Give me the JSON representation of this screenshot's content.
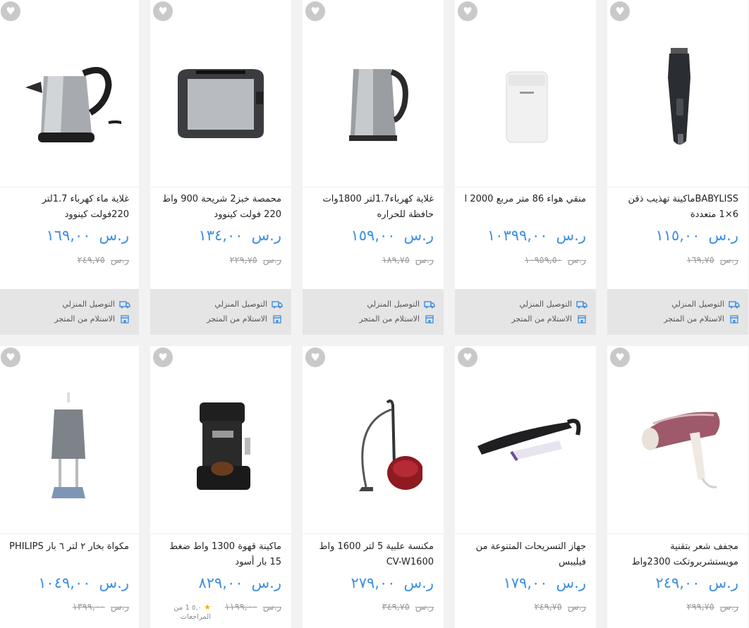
{
  "labels": {
    "home_delivery": "التوصيل المنزلي",
    "store_pickup": "الاستلام من المتجر"
  },
  "colors": {
    "price": "#3d8fe0",
    "favorite_bg": "#c9c9c9",
    "footer_bg": "#e5e5e5"
  },
  "products": [
    {
      "title": "BABYLISSماكينة تهذيب ذقن 6×1 متعددة",
      "currency": "ر.س",
      "price": "١١٥,٠٠",
      "old_currency": "ر.س",
      "old_price": "١٦٩,٧٥",
      "icon": "beard-trimmer-image"
    },
    {
      "title": "منقي هواء 86 متر مربع 2000 ا",
      "currency": "ر.س",
      "price": "١٠٣٩٩,٠٠",
      "old_currency": "ر.س",
      "old_price": "١٠٩٥٩,٥٠",
      "icon": "air-purifier-image"
    },
    {
      "title": "غلاية كهرباء1.7لتر 1800وات حافظة للحراره",
      "currency": "ر.س",
      "price": "١٥٩,٠٠",
      "old_currency": "ر.س",
      "old_price": "١٨٩,٧٥",
      "icon": "steel-kettle-image"
    },
    {
      "title": "محمصة خبز2 شريحة 900 واط 220 فولت كينوود",
      "currency": "ر.س",
      "price": "١٣٤,٠٠",
      "old_currency": "ر.س",
      "old_price": "٢٢٩,٧٥",
      "icon": "toaster-image"
    },
    {
      "title": "غلاية ماء كهرباء 1.7لتر 220فولت كينوود",
      "currency": "ر.س",
      "price": "١٦٩,٠٠",
      "old_currency": "ر.س",
      "old_price": "٢٤٩,٧٥",
      "icon": "kettle-image"
    },
    {
      "title": "مجفف شعر بتقنية مويستشربروتكت 2300واط",
      "currency": "ر.س",
      "price": "٢٤٩,٠٠",
      "old_currency": "ر.س",
      "old_price": "٢٩٩,٧٥",
      "icon": "hair-dryer-image"
    },
    {
      "title": "جهاز التسريحات المتنوعة من فيليبس",
      "currency": "ر.س",
      "price": "١٧٩,٠٠",
      "old_currency": "ر.س",
      "old_price": "٢٤٩,٧٥",
      "icon": "hair-styler-image"
    },
    {
      "title": "مكنسة علبية 5 لتر 1600 واط CV-W1600",
      "currency": "ر.س",
      "price": "٢٧٩,٠٠",
      "old_currency": "ر.س",
      "old_price": "٣٤٩,٧٥",
      "icon": "vacuum-image"
    },
    {
      "title": "ماكينة قهوة 1300 واط ضغط 15 بار أسود",
      "currency": "ر.س",
      "price": "٨٢٩,٠٠",
      "old_currency": "ر.س",
      "old_price": "١١٩٩,٠٠",
      "icon": "coffee-machine-image",
      "rating": "٥,٠",
      "rating_text": "1 من المراجعات"
    },
    {
      "title": "مكواة بخار ٢ لتر ٦ بار PHILIPS",
      "currency": "ر.س",
      "price": "١٠٤٩,٠٠",
      "old_currency": "ر.س",
      "old_price": "١٣٩٩,٠٠",
      "icon": "garment-steamer-image"
    }
  ]
}
